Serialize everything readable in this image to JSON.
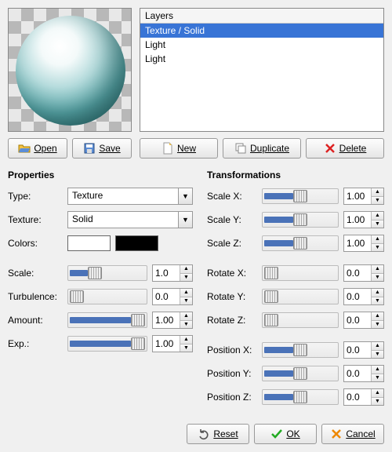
{
  "layers": {
    "header": "Layers",
    "items": [
      {
        "label": "Texture / Solid",
        "selected": true
      },
      {
        "label": "Light",
        "selected": false
      },
      {
        "label": "Light",
        "selected": false
      }
    ]
  },
  "buttons": {
    "open": "Open",
    "save": "Save",
    "new": "New",
    "duplicate": "Duplicate",
    "delete": "Delete",
    "reset": "Reset",
    "ok": "OK",
    "cancel": "Cancel"
  },
  "properties": {
    "heading": "Properties",
    "type_label": "Type:",
    "type_value": "Texture",
    "texture_label": "Texture:",
    "texture_value": "Solid",
    "colors_label": "Colors:",
    "color1": "#FFFFFF",
    "color2": "#000000",
    "sliders": [
      {
        "name": "scale",
        "label": "Scale:",
        "value": "1.0",
        "fill": 0.3
      },
      {
        "name": "turbulence",
        "label": "Turbulence:",
        "value": "0.0",
        "fill": 0.0
      },
      {
        "name": "amount",
        "label": "Amount:",
        "value": "1.00",
        "fill": 1.0
      },
      {
        "name": "exp",
        "label": "Exp.:",
        "value": "1.00",
        "fill": 1.0
      }
    ]
  },
  "transformations": {
    "heading": "Transformations",
    "groups": [
      [
        {
          "name": "scale-x",
          "label": "Scale X:",
          "value": "1.00",
          "fill": 0.5
        },
        {
          "name": "scale-y",
          "label": "Scale Y:",
          "value": "1.00",
          "fill": 0.5
        },
        {
          "name": "scale-z",
          "label": "Scale Z:",
          "value": "1.00",
          "fill": 0.5
        }
      ],
      [
        {
          "name": "rotate-x",
          "label": "Rotate X:",
          "value": "0.0",
          "fill": 0.0
        },
        {
          "name": "rotate-y",
          "label": "Rotate Y:",
          "value": "0.0",
          "fill": 0.0
        },
        {
          "name": "rotate-z",
          "label": "Rotate Z:",
          "value": "0.0",
          "fill": 0.0
        }
      ],
      [
        {
          "name": "position-x",
          "label": "Position X:",
          "value": "0.0",
          "fill": 0.5
        },
        {
          "name": "position-y",
          "label": "Position Y:",
          "value": "0.0",
          "fill": 0.5
        },
        {
          "name": "position-z",
          "label": "Position Z:",
          "value": "0.0",
          "fill": 0.5
        }
      ]
    ]
  }
}
